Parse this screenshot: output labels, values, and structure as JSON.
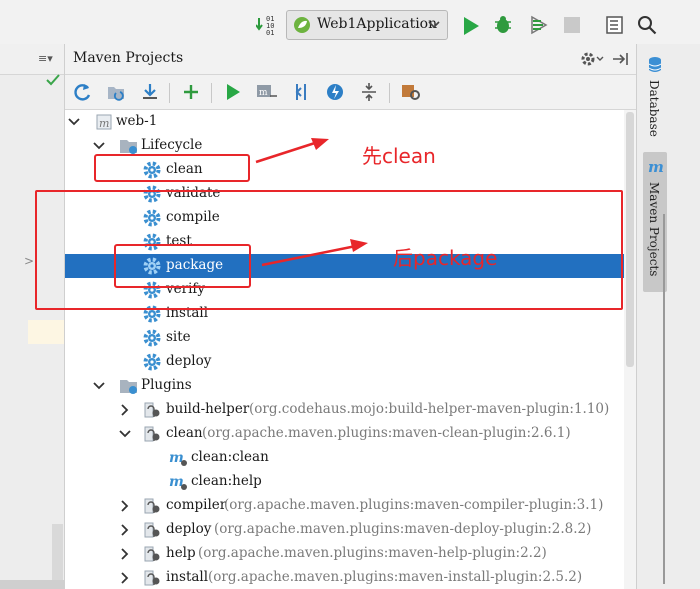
{
  "toolbar": {
    "run_config": "Web1Application",
    "binary_icon": "01\n10\n01"
  },
  "panel": {
    "title": "Maven Projects"
  },
  "right_tabs": {
    "database": "Database",
    "maven": "Maven Projects"
  },
  "tree": {
    "project": "web-1",
    "lifecycle": "Lifecycle",
    "phases": [
      "clean",
      "validate",
      "compile",
      "test",
      "package",
      "verify",
      "install",
      "site",
      "deploy"
    ],
    "selected_phase": "package",
    "plugins_label": "Plugins",
    "plugins": [
      {
        "name": "build-helper",
        "coords": "(org.codehaus.mojo:build-helper-maven-plugin:1.10)",
        "expanded": false
      },
      {
        "name": "clean",
        "coords": "(org.apache.maven.plugins:maven-clean-plugin:2.6.1)",
        "expanded": true,
        "goals": [
          "clean:clean",
          "clean:help"
        ]
      },
      {
        "name": "compiler",
        "coords": "(org.apache.maven.plugins:maven-compiler-plugin:3.1)",
        "expanded": false
      },
      {
        "name": "deploy",
        "coords": "(org.apache.maven.plugins:maven-deploy-plugin:2.8.2)",
        "expanded": false
      },
      {
        "name": "help",
        "coords": "(org.apache.maven.plugins:maven-help-plugin:2.2)",
        "expanded": false
      },
      {
        "name": "install",
        "coords": "(org.apache.maven.plugins:maven-install-plugin:2.5.2)",
        "expanded": false
      }
    ]
  },
  "annotations": {
    "first": "先clean",
    "second": "后package"
  },
  "colors": {
    "selection": "#2270c0",
    "annotation": "#e8262a",
    "gear": "#3a8fd0",
    "run": "#28a745"
  }
}
